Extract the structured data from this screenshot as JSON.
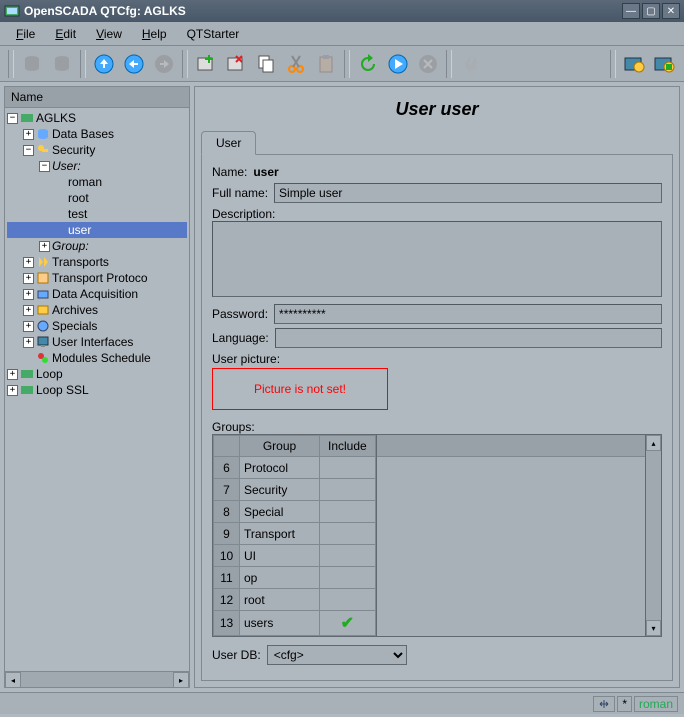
{
  "window": {
    "title": "OpenSCADA QTCfg: AGLKS"
  },
  "menu": {
    "file": "File",
    "edit": "Edit",
    "view": "View",
    "help": "Help",
    "qtstarter": "QTStarter"
  },
  "tree": {
    "header": "Name",
    "root": "AGLKS",
    "nodes": {
      "databases": "Data Bases",
      "security": "Security",
      "user_group": "User:",
      "user_roman": "roman",
      "user_root": "root",
      "user_test": "test",
      "user_user": "user",
      "group_group": "Group:",
      "transports": "Transports",
      "transport_protocols": "Transport Protoco",
      "data_acq": "Data Acquisition",
      "archives": "Archives",
      "specials": "Specials",
      "user_interfaces": "User Interfaces",
      "modules_sched": "Modules Schedule",
      "loop": "Loop",
      "loop_ssl": "Loop SSL"
    }
  },
  "page": {
    "title": "User user",
    "tab": "User",
    "name_label": "Name:",
    "name_value": "user",
    "fullname_label": "Full name:",
    "fullname_value": "Simple user",
    "description_label": "Description:",
    "description_value": "",
    "password_label": "Password:",
    "password_value": "**********",
    "language_label": "Language:",
    "language_value": "",
    "picture_label": "User picture:",
    "picture_text": "Picture is not set!",
    "groups_label": "Groups:",
    "groups_header": {
      "group": "Group",
      "include": "Include"
    },
    "groups": [
      {
        "n": "6",
        "name": "Protocol",
        "include": false
      },
      {
        "n": "7",
        "name": "Security",
        "include": false
      },
      {
        "n": "8",
        "name": "Special",
        "include": false
      },
      {
        "n": "9",
        "name": "Transport",
        "include": false
      },
      {
        "n": "10",
        "name": "UI",
        "include": false
      },
      {
        "n": "11",
        "name": "op",
        "include": false
      },
      {
        "n": "12",
        "name": "root",
        "include": false
      },
      {
        "n": "13",
        "name": "users",
        "include": true
      }
    ],
    "userdb_label": "User DB:",
    "userdb_value": "<cfg>"
  },
  "status": {
    "indicator": "*",
    "user": "roman"
  }
}
